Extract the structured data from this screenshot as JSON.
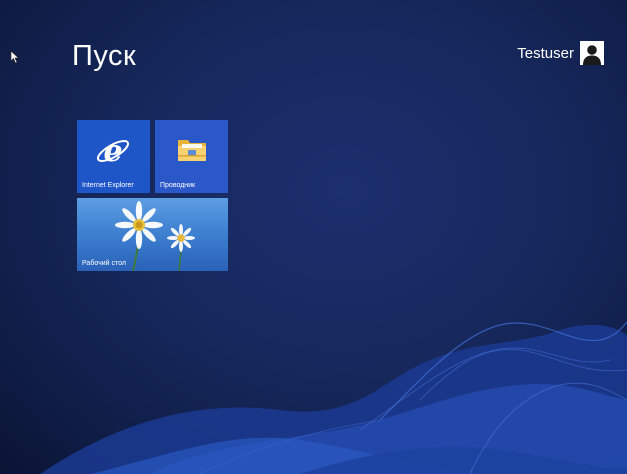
{
  "screen": {
    "title": "Пуск"
  },
  "user": {
    "name": "Testuser",
    "avatar_icon": "user-silhouette-icon"
  },
  "tiles": [
    {
      "label": "Internet Explorer",
      "icon": "internet-explorer-icon",
      "color": "#1e56c8"
    },
    {
      "label": "Проводник",
      "icon": "folder-icon",
      "color": "#2b58c8"
    },
    {
      "label": "Рабочий стол",
      "icon": "daisy-wallpaper",
      "color": "#3d7fd0"
    }
  ],
  "colors": {
    "background": "#16285c",
    "wave": "#2c4da8"
  }
}
